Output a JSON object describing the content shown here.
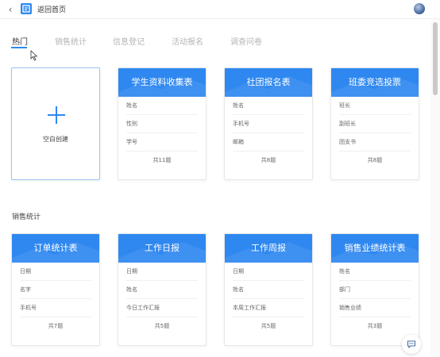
{
  "header": {
    "home_label": "返回首页"
  },
  "tabs": [
    {
      "label": "热门"
    },
    {
      "label": "销售统计"
    },
    {
      "label": "信息登记"
    },
    {
      "label": "活动报名"
    },
    {
      "label": "调查问卷"
    }
  ],
  "blank_card": {
    "label": "空白创建"
  },
  "section": {
    "title": "销售统计"
  },
  "hot_cards": [
    {
      "title": "学生资料收集表",
      "fields": [
        "姓名",
        "性别",
        "学号"
      ],
      "footer": "共11题"
    },
    {
      "title": "社团报名表",
      "fields": [
        "姓名",
        "手机号",
        "邮箱"
      ],
      "footer": "共8题"
    },
    {
      "title": "班委竞选投票",
      "fields": [
        "班长",
        "副班长",
        "团支书"
      ],
      "footer": "共8题"
    }
  ],
  "sales_cards": [
    {
      "title": "订单统计表",
      "fields": [
        "日期",
        "名字",
        "手机号"
      ],
      "footer": "共7题"
    },
    {
      "title": "工作日报",
      "fields": [
        "日期",
        "姓名",
        "今日工作汇报"
      ],
      "footer": "共5题"
    },
    {
      "title": "工作周报",
      "fields": [
        "日期",
        "姓名",
        "本周工作汇报"
      ],
      "footer": "共5题"
    },
    {
      "title": "销售业绩统计表",
      "fields": [
        "姓名",
        "部门",
        "销售业绩"
      ],
      "footer": "共3题"
    }
  ],
  "colors": {
    "accent": "#2f88f0"
  },
  "icons": {
    "back": "chevron-left-icon",
    "logo": "app-logo-icon",
    "chat": "chat-bubble-icon"
  }
}
